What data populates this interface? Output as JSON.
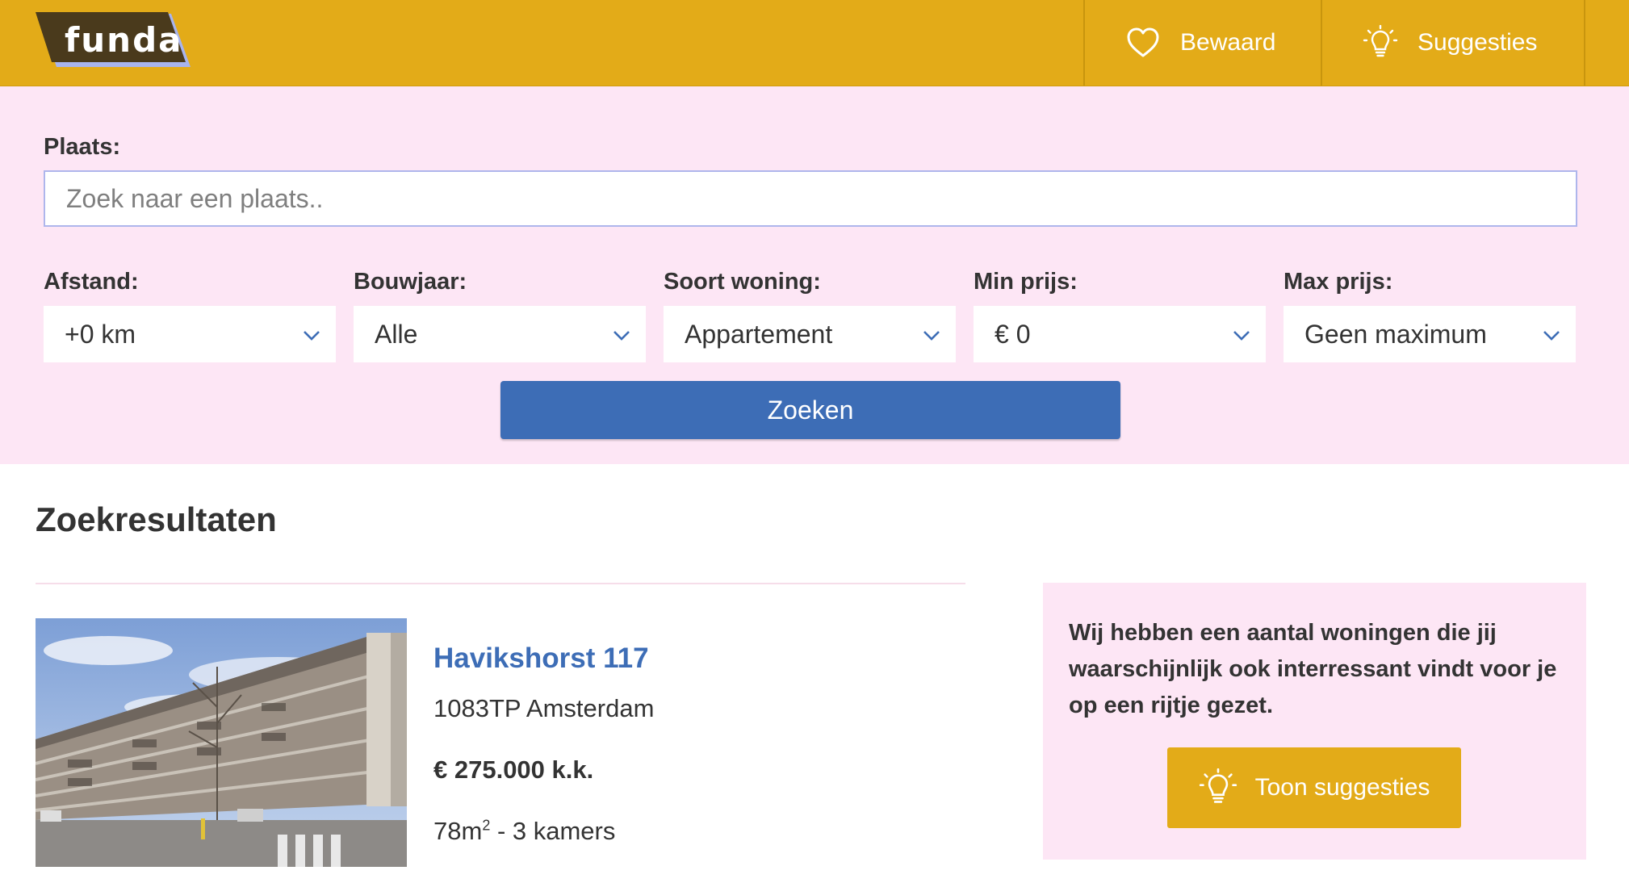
{
  "header": {
    "logo_text": "funda",
    "nav": {
      "saved_label": "Bewaard",
      "saved_icon": "heart-icon",
      "suggestions_label": "Suggesties",
      "suggestions_icon": "lightbulb-icon"
    },
    "background_color": "#e3ab18"
  },
  "search": {
    "place_label": "Plaats:",
    "place_placeholder": "Zoek naar een plaats..",
    "place_value": "",
    "filters": [
      {
        "label": "Afstand:",
        "value": "+0 km"
      },
      {
        "label": "Bouwjaar:",
        "value": "Alle"
      },
      {
        "label": "Soort woning:",
        "value": "Appartement"
      },
      {
        "label": "Min prijs:",
        "value": "€ 0"
      },
      {
        "label": "Max prijs:",
        "value": "Geen maximum"
      }
    ],
    "submit_label": "Zoeken",
    "panel_color": "#fde6f5",
    "button_color": "#3d6db6"
  },
  "results": {
    "title": "Zoekresultaten",
    "items": [
      {
        "title": "Havikshorst 117",
        "address": "1083TP Amsterdam",
        "price": "€ 275.000 k.k.",
        "area": "78m",
        "area_sup": "2",
        "rooms": " - 3 kamers"
      }
    ]
  },
  "suggestions_box": {
    "text": "Wij hebben een aantal woningen die jij waarschijnlijk ook interressant vindt voor je op een rijtje gezet.",
    "button_label": "Toon suggesties",
    "button_icon": "lightbulb-icon"
  }
}
